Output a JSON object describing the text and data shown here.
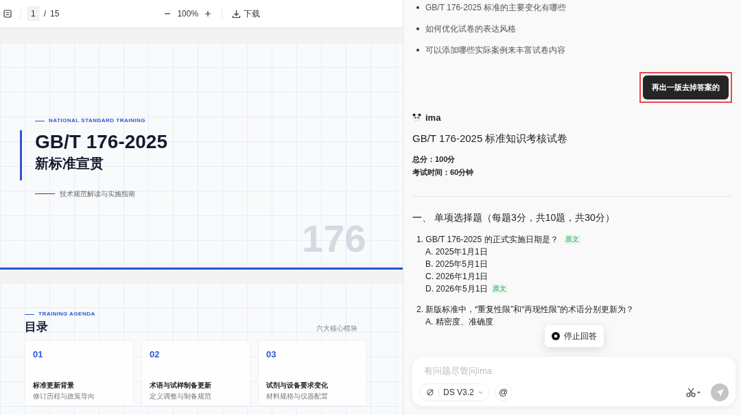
{
  "viewer": {
    "page": "1",
    "separator": "/",
    "total": "15",
    "zoom": "100%",
    "download": "下载"
  },
  "slides": [
    {
      "kind": "cover",
      "eyebrow": "NATIONAL STANDARD TRAINING",
      "title": "GB/T 176-2025",
      "subtitle": "新标准宣贯",
      "tagline": "技术规范解读与实施指南",
      "watermark": "176"
    },
    {
      "kind": "agenda",
      "eyebrow": "TRAINING AGENDA",
      "title": "目录",
      "note": "六大核心模块",
      "cards": [
        {
          "number": "01",
          "title": "标准更新背景",
          "desc": "修订历程与政策导向"
        },
        {
          "number": "02",
          "title": "术语与试样制备更新",
          "desc": "定义调整与制备规范"
        },
        {
          "number": "03",
          "title": "试剂与设备要求变化",
          "desc": "材料规格与仪器配置"
        }
      ]
    }
  ],
  "chat": {
    "suggestions": [
      "GB/T 176-2025 标准的主要变化有哪些",
      "如何优化试卷的表达风格",
      "可以添加哪些实际案例来丰富试卷内容"
    ],
    "user_message": {
      "text": "再出一版去掉答案的",
      "highlighted": true
    },
    "assistant": {
      "name": "ima",
      "title": "GB/T 176-2025 标准知识考核试卷",
      "meta": [
        {
          "label": "总分：",
          "value": "100分"
        },
        {
          "label": "考试时间：",
          "value": "60分钟"
        }
      ],
      "section": "一、 单项选择题（每题3分，共10题，共30分）",
      "questions": [
        {
          "text": "1. GB/T 176-2025 的正式实施日期是？",
          "source": "原文",
          "options": [
            {
              "text": "A. 2025年1月1日"
            },
            {
              "text": "B. 2025年5月1日"
            },
            {
              "text": "C. 2026年1月1日"
            },
            {
              "text": "D. 2026年5月1日",
              "source": "原文"
            }
          ]
        },
        {
          "text": "2. 新版标准中，“重复性限”和“再现性限”的术语分别更新为？",
          "options": [
            {
              "text": "A. 精密度、准确度"
            }
          ]
        }
      ]
    },
    "stop_button": "停止回答",
    "input": {
      "placeholder": "有问题尽管问ima",
      "model": "DS V3.2",
      "mention": "@"
    }
  }
}
